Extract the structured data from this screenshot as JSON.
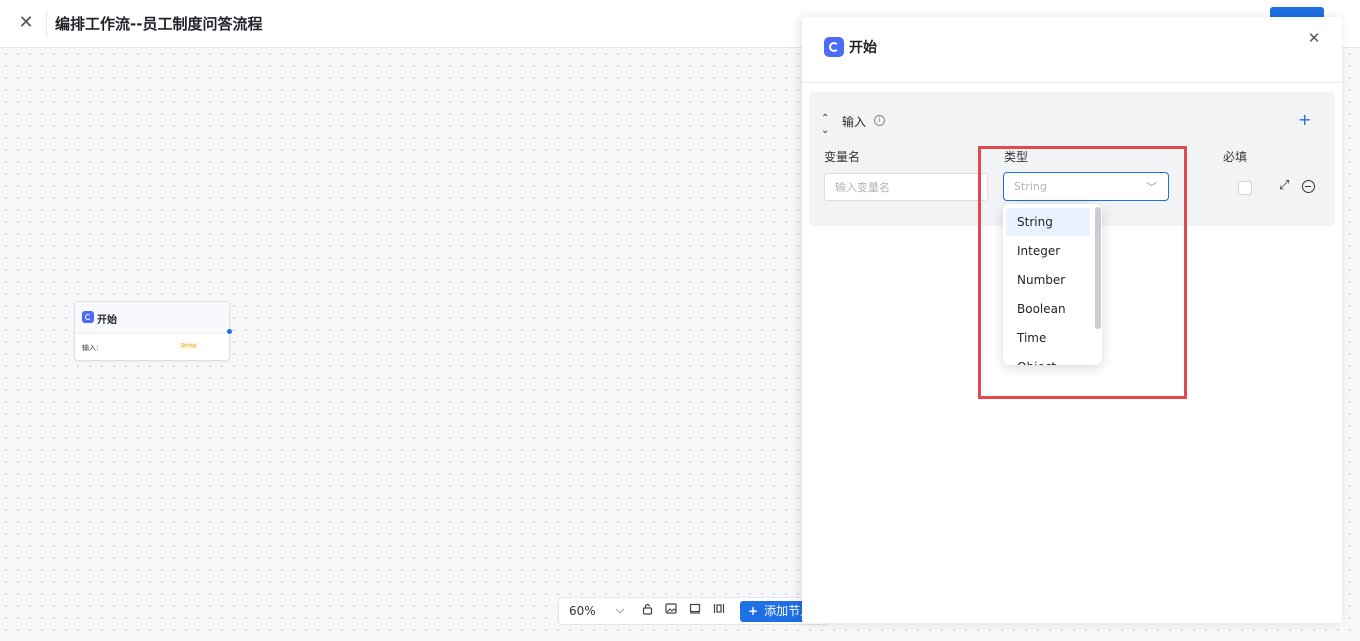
{
  "header": {
    "close_icon": "close-icon",
    "title": "编排工作流--员工制度问答流程"
  },
  "canvas": {
    "start_node": {
      "title": "开始",
      "input_label": "输入:",
      "input_tag": "String"
    },
    "toolbar": {
      "zoom": "60%",
      "add_node_label": "添加节点"
    }
  },
  "panel": {
    "title": "开始",
    "section": {
      "title": "输入",
      "columns": {
        "name": "变量名",
        "type": "类型",
        "required": "必填"
      },
      "name_placeholder": "输入变量名",
      "type_value": "String"
    },
    "dropdown": {
      "options": [
        "String",
        "Integer",
        "Number",
        "Boolean",
        "Time",
        "Object"
      ],
      "selected": "String"
    }
  },
  "colors": {
    "accent": "#1f6fe5",
    "highlight": "#e5484d",
    "node_icon": "#4a6cf7"
  }
}
